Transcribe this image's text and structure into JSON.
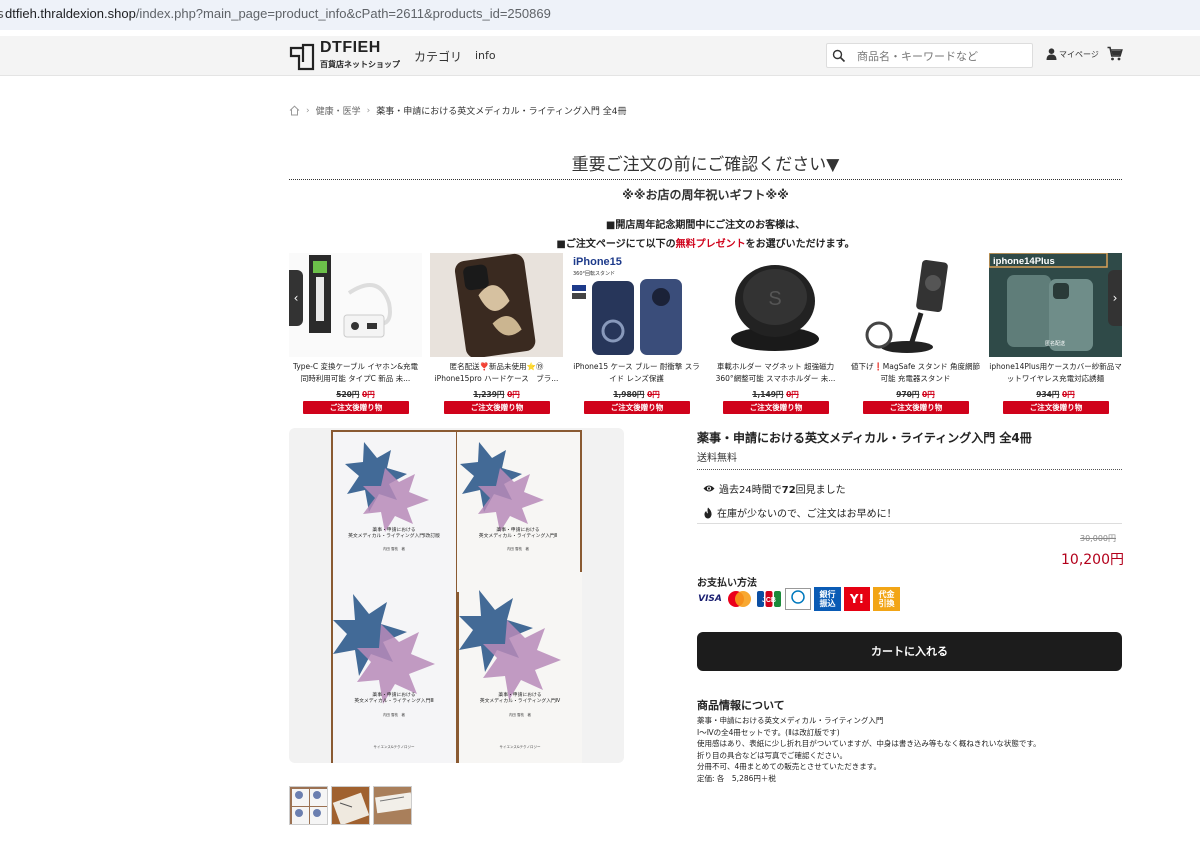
{
  "browser": {
    "url_domain": "dtfieh.thraldexion.shop",
    "url_path": "/index.php?main_page=product_info&cPath=2611&products_id=250869"
  },
  "header": {
    "logo_name": "DTFIEH",
    "logo_sub": "百貨店ネットショップ",
    "nav_category": "カテゴリ",
    "nav_info": "info",
    "search_placeholder": "商品名・キーワードなど",
    "mypage": "マイページ"
  },
  "breadcrumb": {
    "category": "健康・医学",
    "current": "薬事・申請における英文メディカル・ライティング入門 全4冊"
  },
  "notice": {
    "title": "重要ご注文の前にご確認ください▼",
    "gift_title": "※※お店の周年祝いギフト※※",
    "line1": "■開店周年記念期間中にご注文のお客様は、",
    "line2_pre": "■ご注文ページにて以下の",
    "line2_red": "無料プレゼント",
    "line2_post": "をお選びいただけます。"
  },
  "gifts": [
    {
      "caption": "Type-C 変換ケーブル イヤホン&充電 同時利用可能 タイプC 新品 未...",
      "old_price": "520円",
      "free": "0円",
      "button": "ご注文後贈り物"
    },
    {
      "caption": "匿名配送❣️新品未使用⭐️⑲ iPhone15pro ハードケース　ブラ...",
      "old_price": "1,239円",
      "free": "0円",
      "button": "ご注文後贈り物"
    },
    {
      "caption": "iPhone15 ケース ブルー 耐衝撃 スライド レンズ保護",
      "old_price": "1,980円",
      "free": "0円",
      "button": "ご注文後贈り物"
    },
    {
      "caption": "車載ホルダー マグネット 超強磁力 360°網整可能 スマホホルダー 未...",
      "old_price": "1,149円",
      "free": "0円",
      "button": "ご注文後贈り物"
    },
    {
      "caption": "値下げ❗️MagSafe スタンド 角度網節可能 充電器スタンド",
      "old_price": "970円",
      "free": "0円",
      "button": "ご注文後贈り物"
    },
    {
      "caption": "iphone14Plus用ケースカバー紗新品マットワイヤレス充電対応誘麺",
      "old_price": "934円",
      "free": "0円",
      "button": "ご注文後贈り物"
    }
  ],
  "gift_image_text": {
    "iphone15": "iPhone15",
    "iphone15_sub": "360°回転スタンド",
    "iphone14plus": "iphone14Plus",
    "anon": "匿名配送"
  },
  "product": {
    "title": "薬事・申請における英文メディカル・ライティング入門 全4冊",
    "shipping": "送料無料",
    "views_pre": "過去24時間で",
    "views_num": "72",
    "views_post": "回見ました",
    "stock": "在庫が少ないので、ご注文はお早めに！",
    "old_price": "30,000円",
    "price": "10,200円",
    "pay_label": "お支払い方法",
    "pay_methods": [
      "VISA",
      "MasterCard",
      "JCB",
      "Diners Club",
      "銀行振込",
      "Y!",
      "代金引換"
    ],
    "cart_button": "カートに入れる",
    "info_title": "商品情報について",
    "info_body": "薬事・申請における英文メディカル・ライティング入門\nⅠ～Ⅳの全4冊セットです。(Ⅱは改訂版です)\n使用感はあり、表紙に少し折れ目がついていますが、中身は書き込み等もなく概ねきれいな状態です。\n折り目の具合などは写真でご確認ください。\n分冊不可、4冊まとめての販売とさせていただきます。\n定価: 各　5,286円＋税",
    "book_titles": [
      "薬事・申請における\n英文メディカル・ライティング入門Ⅰ改訂版",
      "薬事・申請における\n英文メディカル・ライティング入門Ⅱ",
      "薬事・申請における\n英文メディカル・ライティング入門Ⅲ",
      "薬事・申請における\n英文メディカル・ライティング入門Ⅳ"
    ],
    "book_author": "内田 雪枝　著",
    "book_publisher": "サイエンス&テクノロジー"
  },
  "colors": {
    "accent_red": "#d0021b",
    "price_red": "#b3001b",
    "button_dark": "#1c1c1c"
  }
}
